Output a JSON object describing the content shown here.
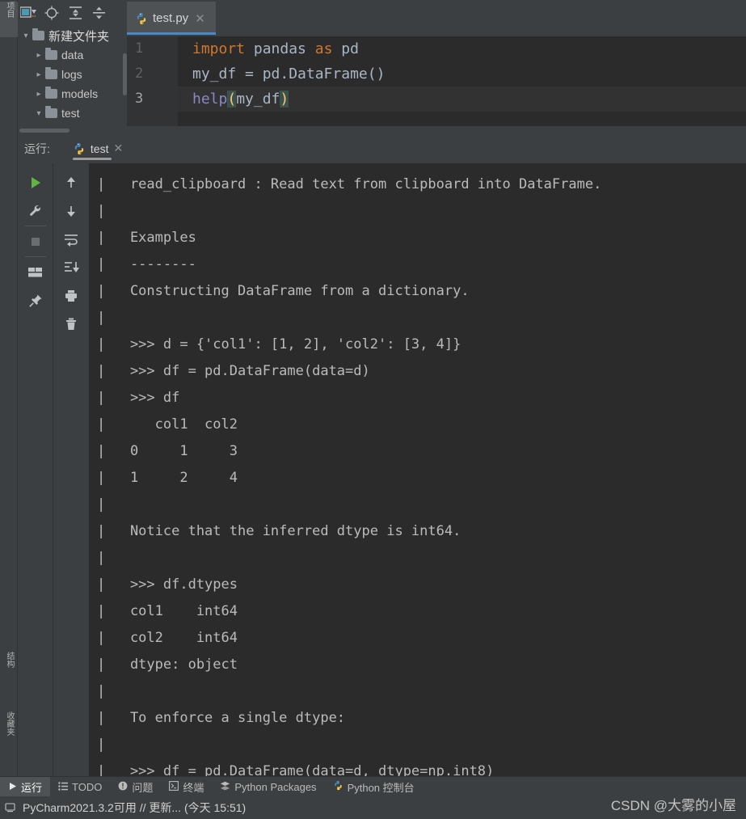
{
  "left_strip": {
    "tabs": [
      {
        "label": "项目",
        "name": "project",
        "selected": true
      },
      {
        "label": "结构",
        "name": "structure",
        "selected": false
      },
      {
        "label": "收藏夹",
        "name": "favorites",
        "selected": false
      }
    ]
  },
  "project_panel": {
    "toolbar": [
      {
        "icon": "view-mode-icon",
        "label": "视图模式"
      },
      {
        "icon": "locate-target-icon",
        "label": "定位"
      },
      {
        "icon": "expand-all-icon",
        "label": "全部展开"
      },
      {
        "icon": "collapse-all-icon",
        "label": "全部折叠"
      }
    ],
    "tree": [
      {
        "label": "新建文件夹",
        "depth": 0,
        "expanded": true,
        "twisty": "chevron-down",
        "cn": true
      },
      {
        "label": "data",
        "depth": 1,
        "expanded": false,
        "twisty": "chevron-right",
        "cn": false
      },
      {
        "label": "logs",
        "depth": 1,
        "expanded": false,
        "twisty": "chevron-right",
        "cn": false
      },
      {
        "label": "models",
        "depth": 1,
        "expanded": false,
        "twisty": "chevron-right",
        "cn": false
      },
      {
        "label": "test",
        "depth": 1,
        "expanded": true,
        "twisty": "chevron-down",
        "cn": false
      }
    ]
  },
  "editor": {
    "tab": {
      "name": "test.py",
      "close": "✕",
      "icon": "python-file-icon"
    },
    "lines": [
      {
        "number": "1",
        "current": false,
        "tokens": [
          {
            "t": "import",
            "c": "kw"
          },
          {
            "t": " pandas ",
            "c": "pln"
          },
          {
            "t": "as",
            "c": "kw"
          },
          {
            "t": " pd",
            "c": "pln"
          }
        ]
      },
      {
        "number": "2",
        "current": false,
        "tokens": [
          {
            "t": "my_df = pd.DataFrame()",
            "c": "pln"
          }
        ]
      },
      {
        "number": "3",
        "current": true,
        "tokens": [
          {
            "t": "help",
            "c": "fn"
          },
          {
            "t": "(",
            "c": "brace"
          },
          {
            "t": "my_df",
            "c": "pln"
          },
          {
            "t": ")",
            "c": "brace"
          }
        ]
      }
    ]
  },
  "run_window": {
    "label": "运行:",
    "tab": {
      "name": "test",
      "close": "✕",
      "icon": "python-run-icon"
    },
    "toolbar_left": [
      {
        "icon": "run-icon",
        "label": "运行"
      },
      {
        "icon": "wrench-icon",
        "label": "编辑配置"
      },
      {
        "sep": true
      },
      {
        "icon": "stop-icon",
        "label": "停止"
      },
      {
        "sep": true
      },
      {
        "icon": "layout-icon",
        "label": "布局"
      },
      {
        "icon": "pin-icon",
        "label": "固定"
      }
    ],
    "toolbar_right": [
      {
        "icon": "arrow-up-icon",
        "label": "上一个"
      },
      {
        "icon": "arrow-down-icon",
        "label": "下一个"
      },
      {
        "icon": "soft-wrap-icon",
        "label": "软换行"
      },
      {
        "icon": "scroll-to-end-icon",
        "label": "滚动到末尾"
      },
      {
        "icon": "print-icon",
        "label": "打印"
      },
      {
        "icon": "trash-icon",
        "label": "清空"
      }
    ]
  },
  "console": {
    "lines": [
      {
        "text": "|   read_clipboard : Read text from clipboard into DataFrame.",
        "selected": false
      },
      {
        "text": "|  ",
        "selected": false
      },
      {
        "text": "|   Examples",
        "selected": false
      },
      {
        "text": "|   --------",
        "selected": false
      },
      {
        "text": "|   Constructing DataFrame from a dictionary.",
        "selected": false
      },
      {
        "text": "|  ",
        "selected": false
      },
      {
        "text": "|   >>> d = {'col1': [1, 2], 'col2': [3, 4]}",
        "selected": false
      },
      {
        "text": "|   >>> df = pd.DataFrame(data=d)",
        "selected": false
      },
      {
        "text": "|   >>> df",
        "selected": false
      },
      {
        "text": "|      col1  col2",
        "selected": false
      },
      {
        "text": "|   0     1     3",
        "selected": false
      },
      {
        "text": "|   1     2     4",
        "selected": false
      },
      {
        "text": "|  ",
        "selected": false
      },
      {
        "text": "|   Notice that the inferred dtype is int64.",
        "selected": false
      },
      {
        "text": "|  ",
        "selected": false
      },
      {
        "text": "|   >>> df.dtypes",
        "selected": false
      },
      {
        "text": "|   col1    int64",
        "selected": false
      },
      {
        "text": "|   col2    int64",
        "selected": false
      },
      {
        "text": "|   dtype: object",
        "selected": false
      },
      {
        "text": "|  ",
        "selected": false
      },
      {
        "text": "|   To enforce a single dtype:",
        "selected": false
      },
      {
        "text": "|  ",
        "selected": false
      },
      {
        "text": "|   >>> df = pd.DataFrame(data=d, dtype=np.int8)",
        "selected": true
      }
    ]
  },
  "bottom_tools": [
    {
      "label": "运行",
      "icon": "run-small-icon",
      "active": true
    },
    {
      "label": "TODO",
      "icon": "todo-icon",
      "active": false
    },
    {
      "label": "问题",
      "icon": "problems-icon",
      "active": false
    },
    {
      "label": "终端",
      "icon": "terminal-icon",
      "active": false
    },
    {
      "label": "Python Packages",
      "icon": "packages-icon",
      "active": false
    },
    {
      "label": "Python 控制台",
      "icon": "python-console-icon",
      "active": false
    }
  ],
  "statusbar": {
    "text": "PyCharm2021.3.2可用 // 更新... (今天 15:51)",
    "icon": "notification-icon"
  },
  "watermark": "CSDN @大雾的小屋",
  "colors": {
    "panel_bg": "#3c3f41",
    "editor_bg": "#2b2b2b",
    "gutter_bg": "#313335",
    "tab_active_bg": "#4e5254",
    "tab_underline": "#4a88c7",
    "keyword": "#cc7832",
    "plain_text": "#a9b7c6",
    "function": "#8888c6",
    "brace_match": "#ffc66d",
    "run_green": "#62b543",
    "console_text": "#bbbbbb"
  }
}
